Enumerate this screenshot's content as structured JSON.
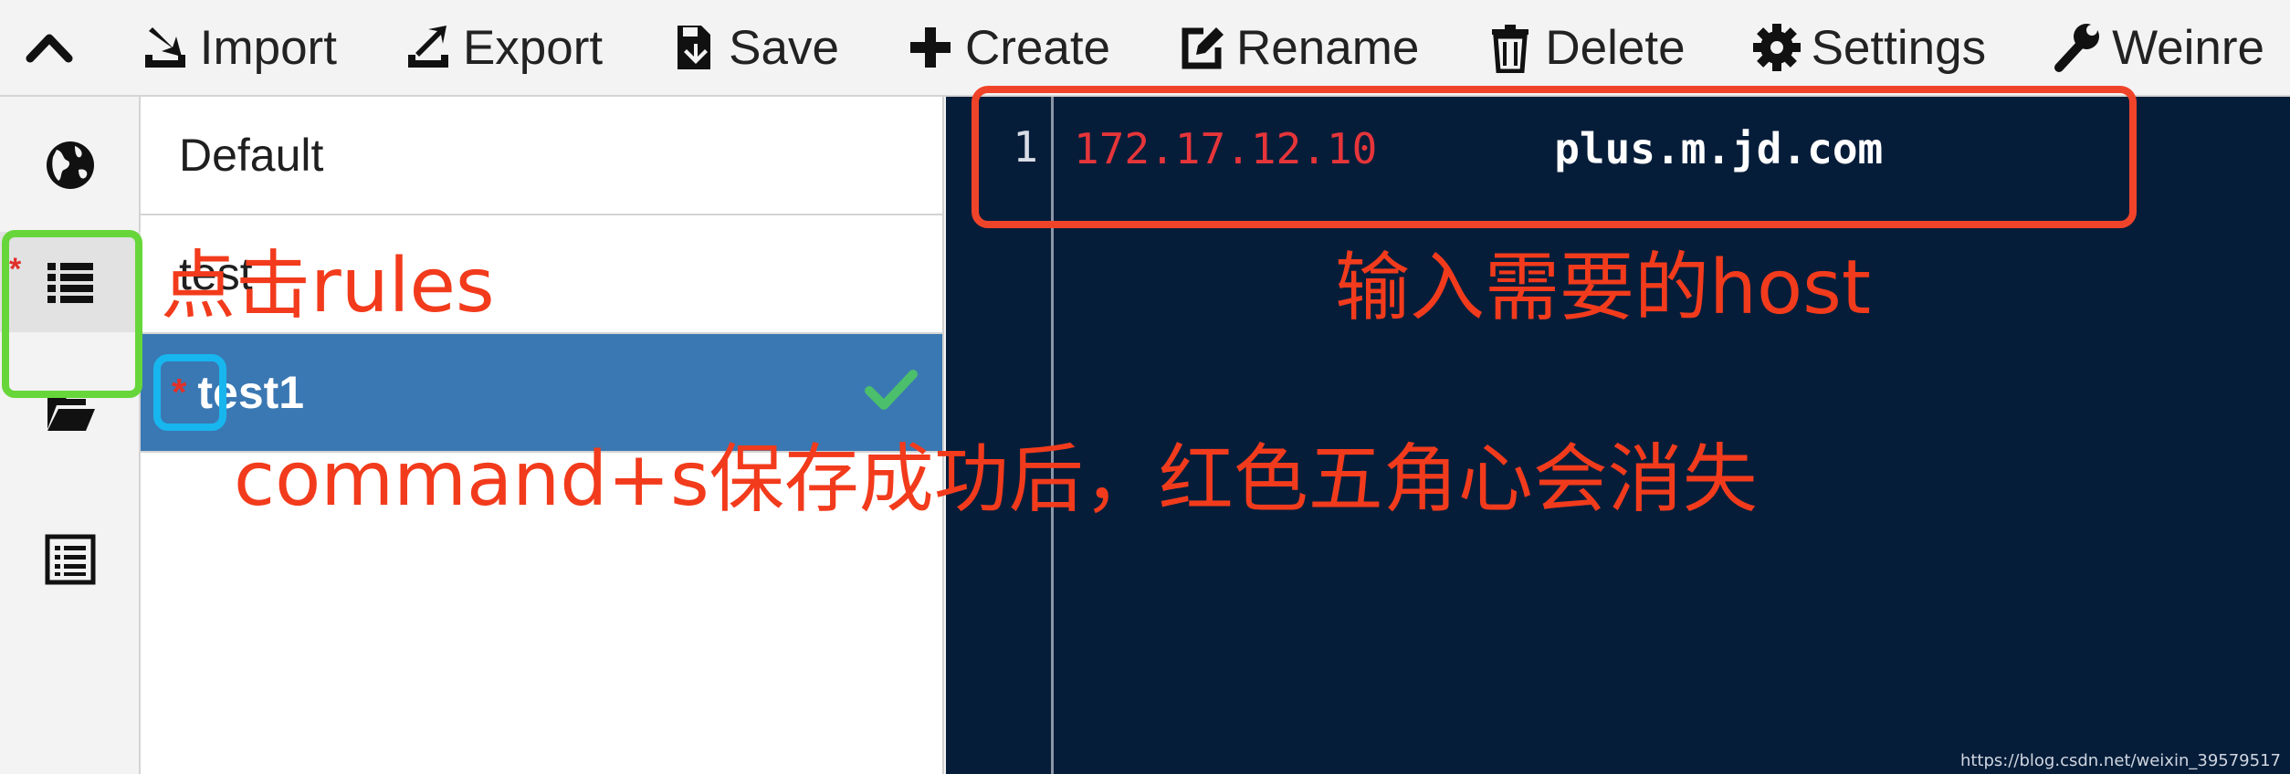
{
  "toolbar": {
    "buttons": [
      {
        "label": "Import",
        "icon": "import-icon"
      },
      {
        "label": "Export",
        "icon": "export-icon"
      },
      {
        "label": "Save",
        "icon": "save-icon"
      },
      {
        "label": "Create",
        "icon": "plus-icon"
      },
      {
        "label": "Rename",
        "icon": "edit-icon"
      },
      {
        "label": "Delete",
        "icon": "trash-icon"
      },
      {
        "label": "Settings",
        "icon": "gear-icon"
      },
      {
        "label": "Weinre",
        "icon": "wrench-icon"
      }
    ]
  },
  "sidebar": {
    "items": [
      {
        "icon": "globe-icon",
        "active": false
      },
      {
        "icon": "list-icon",
        "active": true,
        "dirty_marker": "*"
      },
      {
        "icon": "folder-open-icon",
        "active": false
      },
      {
        "icon": "log-list-icon",
        "active": false
      }
    ]
  },
  "rules_list": {
    "items": [
      {
        "name": "Default",
        "selected": false
      },
      {
        "name": "test",
        "selected": false
      },
      {
        "name": "test1",
        "selected": true,
        "dirty_marker": "*"
      }
    ]
  },
  "editor": {
    "line_number": "1",
    "ip": "172.17.12.10",
    "spacing": "       ",
    "host": "plus.m.jd.com"
  },
  "annotations": {
    "click_rules": "点击rules",
    "enter_host": "输入需要的host",
    "save_hint": "command+s保存成功后，红色五角心会消失"
  },
  "colors": {
    "annotation": "#f23b1c",
    "highlight_green": "#67d63a",
    "highlight_cyan": "#18b6ee",
    "selected_row": "#3a78b3",
    "editor_bg": "#061d3a"
  },
  "watermark": "https://blog.csdn.net/weixin_39579517"
}
